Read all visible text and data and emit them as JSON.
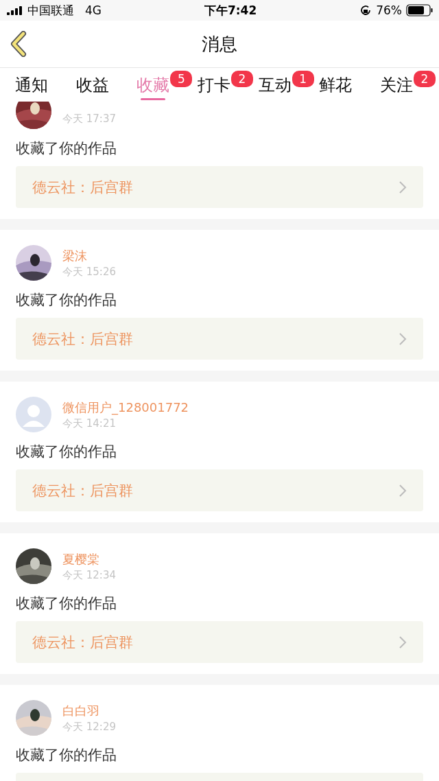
{
  "status_bar": {
    "carrier": "中国联通",
    "network": "4G",
    "time": "下午7:42",
    "battery": "76%"
  },
  "nav": {
    "title": "消息"
  },
  "tabs": [
    {
      "label": "通知",
      "selected": false
    },
    {
      "label": "收益",
      "selected": false
    },
    {
      "label": "收藏",
      "selected": true,
      "badge": "5"
    },
    {
      "label": "打卡",
      "selected": false,
      "badge": "2"
    },
    {
      "label": "互动",
      "selected": false,
      "badge": "1"
    },
    {
      "label": "鲜花",
      "selected": false
    },
    {
      "label": "关注",
      "selected": false,
      "badge": "2"
    }
  ],
  "messages": [
    {
      "kind": "picture",
      "time": "今天 17:37",
      "text": "收藏了你的作品",
      "link": "德云社：后宫群"
    },
    {
      "kind": "picture",
      "name": "梁沫",
      "time": "今天 15:26",
      "text": "收藏了你的作品",
      "link": "德云社：后宫群"
    },
    {
      "kind": "default",
      "name": "微信用户_128001772",
      "time": "今天 14:21",
      "text": "收藏了你的作品",
      "link": "德云社：后宫群"
    },
    {
      "kind": "picture",
      "name": "夏樱棠",
      "time": "今天 12:34",
      "text": "收藏了你的作品",
      "link": "德云社：后宫群"
    },
    {
      "kind": "picture",
      "name": "白白羽",
      "time": "今天 12:29",
      "text": "收藏了你的作品"
    }
  ]
}
